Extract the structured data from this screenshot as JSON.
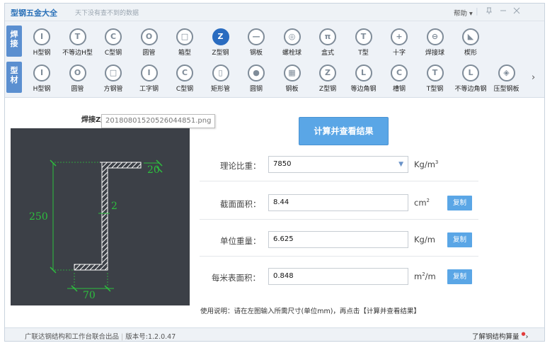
{
  "window": {
    "title": "型钢五金大全",
    "subtitle": "天下没有查不到的数据",
    "help_label": "帮助",
    "help_arrow": "▾",
    "pin_icon": "pin-icon",
    "minimize_icon": "minimize-icon",
    "close_icon": "close-icon"
  },
  "categories": [
    {
      "label_top": "焊",
      "label_bottom": "接",
      "color": "#5b8fd0"
    },
    {
      "label_top": "型",
      "label_bottom": "材",
      "color": "#5b8fd0"
    }
  ],
  "welded_items": [
    {
      "label": "H型钢",
      "glyph": "I"
    },
    {
      "label": "不等边H型",
      "glyph": "T"
    },
    {
      "label": "C型钢",
      "glyph": "C"
    },
    {
      "label": "圆管",
      "glyph": "O"
    },
    {
      "label": "箱型",
      "glyph": "□"
    },
    {
      "label": "Z型钢",
      "glyph": "Z"
    },
    {
      "label": "钢板",
      "glyph": "—"
    },
    {
      "label": "螺栓球",
      "glyph": "◎"
    },
    {
      "label": "盒式",
      "glyph": "π"
    },
    {
      "label": "T型",
      "glyph": "T"
    },
    {
      "label": "十字",
      "glyph": "+"
    },
    {
      "label": "焊接球",
      "glyph": "⊖"
    },
    {
      "label": "楔形",
      "glyph": "◣"
    }
  ],
  "profile_items": [
    {
      "label": "H型钢",
      "glyph": "I"
    },
    {
      "label": "圆管",
      "glyph": "O"
    },
    {
      "label": "方钢管",
      "glyph": "□"
    },
    {
      "label": "工字钢",
      "glyph": "I"
    },
    {
      "label": "C型钢",
      "glyph": "C"
    },
    {
      "label": "矩形管",
      "glyph": "▯"
    },
    {
      "label": "圆钢",
      "glyph": "●"
    },
    {
      "label": "钢板",
      "glyph": "▦"
    },
    {
      "label": "Z型钢",
      "glyph": "Z"
    },
    {
      "label": "等边角钢",
      "glyph": "L"
    },
    {
      "label": "槽钢",
      "glyph": "C"
    },
    {
      "label": "T型钢",
      "glyph": "T"
    },
    {
      "label": "不等边角钢",
      "glyph": "L"
    },
    {
      "label": "压型钢板",
      "glyph": "◈"
    }
  ],
  "more_arrow": "›",
  "drawing": {
    "caption": "焊接Z型钢",
    "filename_tooltip": "20180801520526044851.png",
    "dim_height": "250",
    "dim_thickness": "2",
    "dim_top_flange": "20",
    "dim_bottom_flange": "70",
    "line_color": "#ffffff",
    "dim_color": "#2dbf3e"
  },
  "calculate_button": "计算并查看结果",
  "fields": {
    "density": {
      "label": "理论比重：",
      "value": "7850",
      "unit": "Kg/m",
      "unit_sup": "3"
    },
    "area": {
      "label": "截面面积：",
      "value": "8.44",
      "unit": "cm",
      "unit_sup": "2",
      "copy_label": "复制"
    },
    "weight": {
      "label": "单位重量：",
      "value": "6.625",
      "unit": "Kg/m",
      "copy_label": "复制"
    },
    "surface": {
      "label": "每米表面积：",
      "value": "0.848",
      "unit_pre": "m",
      "unit_sup": "2",
      "unit_post": "/m",
      "copy_label": "复制"
    }
  },
  "usage_note": "使用说明：请在左图输入所需尺寸(单位mm)，再点击【计算并查看结果】",
  "statusbar": {
    "publisher": "广联达钢结构和工作台联合出品",
    "version": "版本号:1.2.0.47",
    "link": "了解钢结构算量",
    "link_arrow": "›"
  },
  "colors": {
    "accent": "#2a6cc0",
    "button": "#5aa6e6",
    "drawing_bg": "#3c4047"
  }
}
